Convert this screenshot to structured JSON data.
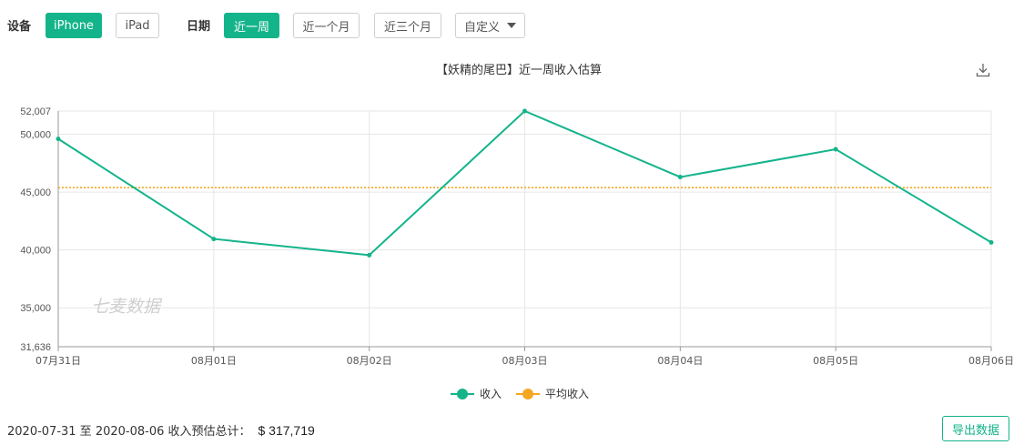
{
  "filters": {
    "device_label": "设备",
    "devices": [
      {
        "label": "iPhone",
        "active": true
      },
      {
        "label": "iPad",
        "active": false
      }
    ],
    "date_label": "日期",
    "ranges": [
      {
        "label": "近一周",
        "active": true
      },
      {
        "label": "近一个月",
        "active": false
      },
      {
        "label": "近三个月",
        "active": false
      }
    ],
    "custom_label": "自定义"
  },
  "chart": {
    "title": "【妖精的尾巴】近一周收入估算",
    "watermark": "七麦数据",
    "download_icon": "download-icon"
  },
  "chart_data": {
    "type": "line",
    "title": "【妖精的尾巴】近一周收入估算",
    "x": [
      "07月31日",
      "08月01日",
      "08月02日",
      "08月03日",
      "08月04日",
      "08月05日",
      "08月06日"
    ],
    "series": [
      {
        "name": "收入",
        "color": "#14b48b",
        "values": [
          49600,
          40950,
          39550,
          52007,
          46300,
          48700,
          40650
        ]
      },
      {
        "name": "平均收入",
        "color": "#f5a623",
        "values": [
          45388,
          45388,
          45388,
          45388,
          45388,
          45388,
          45388
        ]
      }
    ],
    "yticks": [
      31636,
      35000,
      40000,
      45000,
      50000,
      52007
    ],
    "ytick_labels": [
      "31,636",
      "35,000",
      "40,000",
      "45,000",
      "50,000",
      "52,007"
    ],
    "ylim": [
      31636,
      52007
    ],
    "grid": true,
    "legend": "bottom"
  },
  "summary": {
    "text": "2020-07-31 至 2020-08-06 收入预估总计：",
    "total": "$ 317,719"
  },
  "export_label": "导出数据"
}
